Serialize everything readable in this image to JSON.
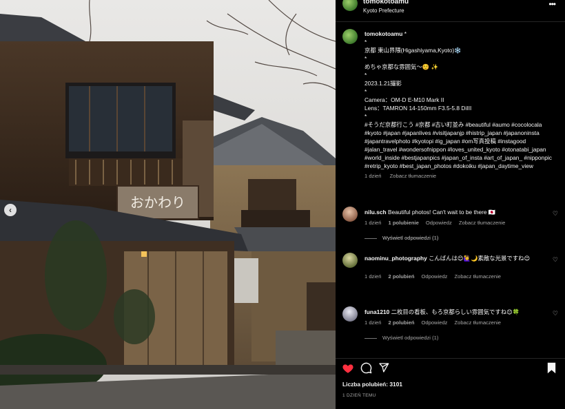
{
  "header": {
    "username": "tomokotoamu",
    "location": "Kyoto Prefecture",
    "more_icon": "more-horizontal-icon"
  },
  "photo": {
    "sign_text": "おかわり",
    "nav_prev_icon": "chevron-left-icon"
  },
  "caption": {
    "username": "tomokotoamu",
    "suffix": " *",
    "lines": [
      "*",
      "京都 東山界隈(Higashiyama,Kyoto)❄️",
      "*",
      "めちゃ京都な雰囲気〜☺️ ✨",
      "*",
      "2023.1.21撮影",
      "*",
      "Camera：OM-D E-M10 Mark II",
      "Lens：TAMRON 14-150mm F3.5-5.8 DiIII",
      "*"
    ],
    "hashtags": "#そうだ京都行こう #京都 #古い町並み #beautiful #aumo #cocolocala #kyoto #japan #japanlives #visitjapanjp #histrip_japan #japanoninsta #japantravelphoto #kyotopi #ig_japan #om写真投稿 #instagood #jalan_travel #wondersofnippon #loves_united_kyoto #otonatabi_japan #world_inside #bestjapanpics #japan_of_insta #art_of_japan_ #nipponpic #retrip_kyoto #best_japan_photos #dokoiku #japan_daytime_view",
    "time": "1 dzień",
    "translate": "Zobacz tłumaczenie"
  },
  "comments": [
    {
      "username": "nilu.sch",
      "text": "Beautiful photos! Can't wait to be there 🇯🇵",
      "time": "1 dzień",
      "likes": "1 polubienie",
      "reply": "Odpowiedz",
      "translate": "Zobacz tłumaczenie",
      "replies": "Wyświetl odpowiedzi (1)",
      "avatar_color": "#b07a5a"
    },
    {
      "username": "naominu_photography",
      "text": "こんばんは😊🙋‍♀️🌙素敵な光景ですね😊",
      "time": "1 dzień",
      "likes": "2 polubień",
      "reply": "Odpowiedz",
      "translate": "Zobacz tłumaczenie",
      "replies": "Wyświetl odpowiedzi (1)",
      "avatar_color": "#7d8a4e"
    },
    {
      "username": "funa1210",
      "text": "二枚目の看板、もろ京都らしい雰囲気ですね😊🍀",
      "time": "1 dzień",
      "likes": "2 polubień",
      "reply": "Odpowiedz",
      "translate": "Zobacz tłumaczenie",
      "replies": "Wyświetl odpowiedzi (1)",
      "avatar_color": "#9a9aa8"
    }
  ],
  "actions": {
    "like_icon": "heart-filled-icon",
    "comment_icon": "comment-icon",
    "share_icon": "send-icon",
    "save_icon": "bookmark-icon",
    "like_color": "#ff3040"
  },
  "likes_label": "Liczba polubień: 3101",
  "post_date": "1 DZIEŃ TEMU"
}
